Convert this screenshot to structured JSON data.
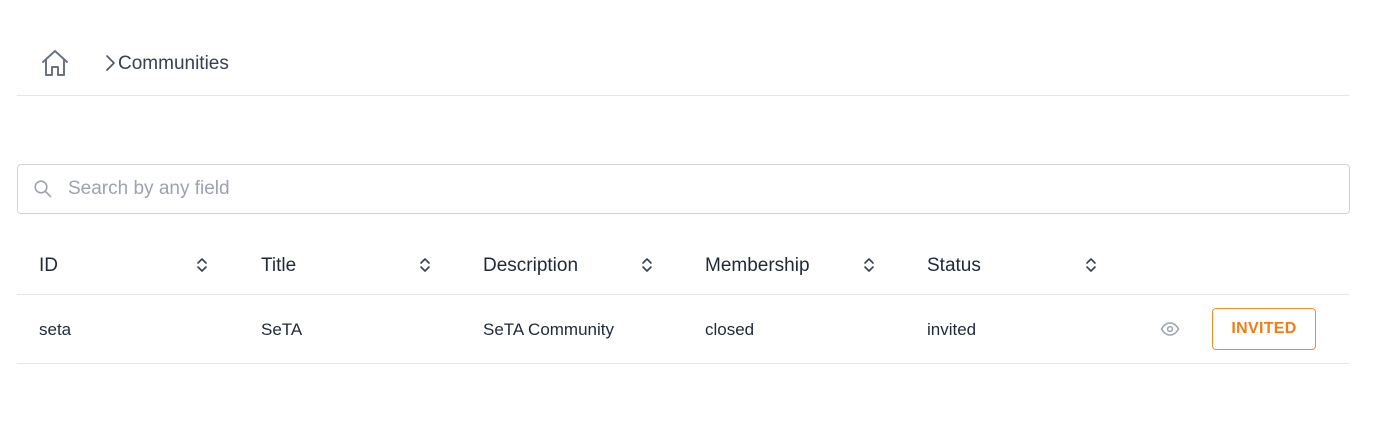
{
  "breadcrumb": {
    "home_icon": "home-icon",
    "separator_icon": "chevron-right-icon",
    "current": "Communities"
  },
  "search": {
    "placeholder": "Search by any field",
    "value": "",
    "icon": "search-icon"
  },
  "table": {
    "columns": [
      {
        "label": "ID",
        "sort_icon": "sort-icon"
      },
      {
        "label": "Title",
        "sort_icon": "sort-icon"
      },
      {
        "label": "Description",
        "sort_icon": "sort-icon"
      },
      {
        "label": "Membership",
        "sort_icon": "sort-icon"
      },
      {
        "label": "Status",
        "sort_icon": "sort-icon"
      }
    ],
    "rows": [
      {
        "id": "seta",
        "title": "SeTA",
        "description": "SeTA Community",
        "membership": "closed",
        "status": "invited",
        "view_icon": "eye-icon",
        "action_label": "INVITED"
      }
    ]
  },
  "colors": {
    "accent_orange": "#f07d14",
    "border": "#e5e7eb",
    "text": "#1f2937",
    "placeholder": "#9ca3af"
  }
}
